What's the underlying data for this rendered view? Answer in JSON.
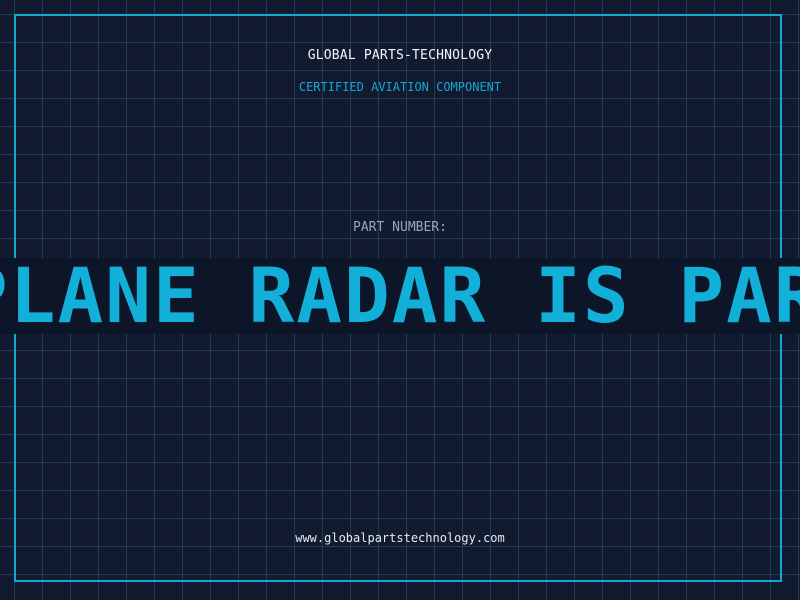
{
  "header": {
    "company": "GLOBAL PARTS-TECHNOLOGY",
    "subtitle": "CERTIFIED AVIATION COMPONENT"
  },
  "part": {
    "label": "PART NUMBER:",
    "value": "PLANE RADAR IS PART"
  },
  "footer": {
    "website": "www.globalpartstechnology.com"
  },
  "colors": {
    "background": "#111a2e",
    "grid": "#225c78",
    "accent": "#12b0d8",
    "text": "#f3f6fa"
  }
}
